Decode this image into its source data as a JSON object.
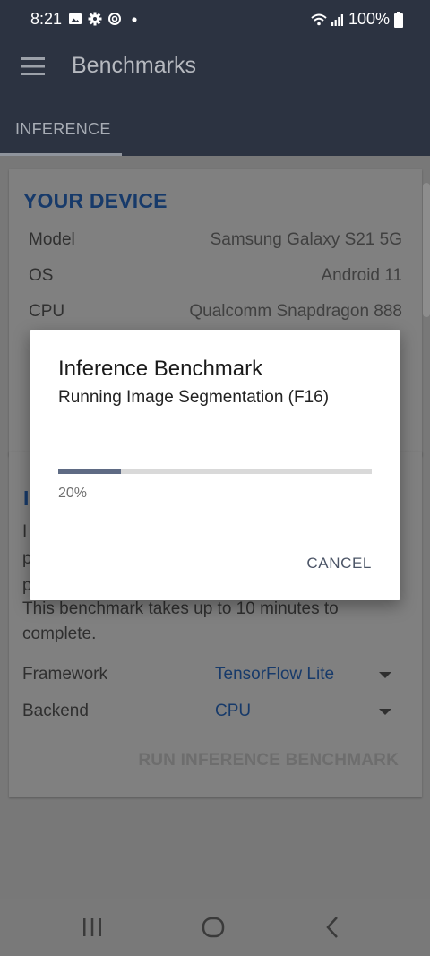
{
  "status_bar": {
    "time": "8:21",
    "battery": "100%",
    "icons_left": [
      "image-icon",
      "gear-icon",
      "sync-icon",
      "dot-icon"
    ],
    "icons_right": [
      "wifi-icon",
      "signal-icon",
      "battery-icon"
    ]
  },
  "app_bar": {
    "title": "Benchmarks",
    "menu_icon": "menu-icon"
  },
  "tabs": [
    {
      "label": "INFERENCE",
      "selected": true
    }
  ],
  "device_card": {
    "title": "YOUR DEVICE",
    "rows": [
      {
        "key": "Model",
        "value": "Samsung Galaxy S21 5G"
      },
      {
        "key": "OS",
        "value": "Android 11"
      },
      {
        "key": "CPU",
        "value": "Qualcomm Snapdragon 888"
      }
    ]
  },
  "inference_card": {
    "title_visible": "I",
    "line1_visible": "I",
    "line2_visible": "p",
    "line3_visible": "p",
    "line4": "This benchmark takes up to 10 minutes to",
    "line5": "complete.",
    "framework": {
      "label": "Framework",
      "value": "TensorFlow Lite"
    },
    "backend": {
      "label": "Backend",
      "value": "CPU"
    },
    "run_button": "RUN INFERENCE BENCHMARK"
  },
  "dialog": {
    "title": "Inference Benchmark",
    "message": "Running Image Segmentation (F16)",
    "progress": 0.2,
    "progress_text": "20%",
    "cancel": "CANCEL"
  },
  "colors": {
    "app_bar": "#2c3341",
    "accent_blue": "#173a6a",
    "progress_fill": "#5f6b84",
    "scrim_content": "#787878"
  }
}
